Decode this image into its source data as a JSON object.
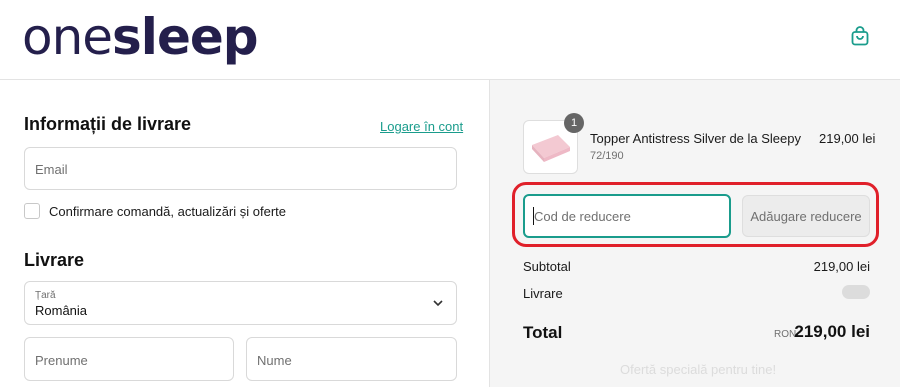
{
  "header": {
    "logo_light": "one",
    "logo_bold": "sleep",
    "cart_icon": "shopping-bag-icon",
    "brand_color": "#241f4c",
    "accent_color": "#1a9c8c"
  },
  "delivery_info": {
    "title": "Informații de livrare",
    "login_link": "Logare în cont",
    "email_placeholder": "Email",
    "marketing_checkbox_label": "Confirmare comandă, actualizări și oferte"
  },
  "shipping": {
    "title": "Livrare",
    "country_label": "Țară",
    "country_value": "România",
    "first_name_placeholder": "Prenume",
    "last_name_placeholder": "Nume"
  },
  "order_summary": {
    "item": {
      "name": "Topper Antistress Silver de la Sleepy",
      "variant": "72/190",
      "price": "219,00 lei",
      "quantity": "1"
    },
    "discount": {
      "placeholder": "Cod de reducere",
      "apply_label": "Adăugare reducere"
    },
    "subtotal_label": "Subtotal",
    "subtotal_value": "219,00 lei",
    "shipping_label": "Livrare",
    "total_label": "Total",
    "currency": "RON",
    "total_value": "219,00 lei",
    "promo_text": "Ofertă specială pentru tine!",
    "highlight_color": "#e0202a"
  }
}
